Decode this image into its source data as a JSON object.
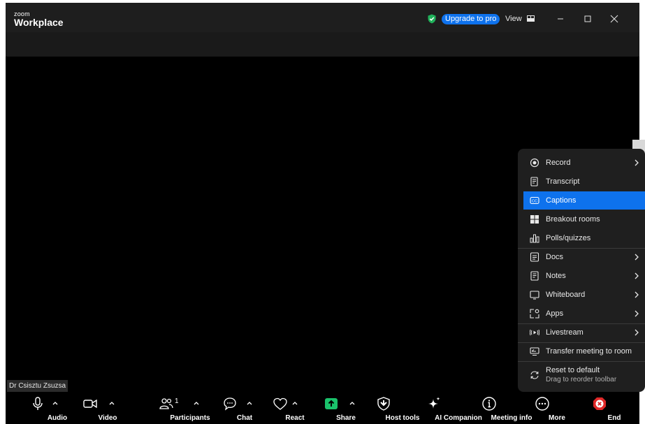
{
  "titlebar": {
    "logo_small": "zoom",
    "logo_big": "Workplace",
    "upgrade_label": "Upgrade to pro",
    "view_label": "View"
  },
  "participant_name": "Dr Csisztu Zsuzsa",
  "toolbar": {
    "audio": "Audio",
    "video": "Video",
    "participants": "Participants",
    "participants_count": "1",
    "chat": "Chat",
    "react": "React",
    "share": "Share",
    "host_tools": "Host tools",
    "ai_companion": "AI Companion",
    "meeting_info": "Meeting info",
    "more": "More",
    "end": "End"
  },
  "more_menu": {
    "items": [
      {
        "label": "Record",
        "icon": "record-icon",
        "submenu": true
      },
      {
        "label": "Transcript",
        "icon": "transcript-icon",
        "submenu": false
      },
      {
        "label": "Captions",
        "icon": "captions-icon",
        "submenu": false,
        "active": true
      },
      {
        "label": "Breakout rooms",
        "icon": "breakout-rooms-icon",
        "submenu": false
      },
      {
        "label": "Polls/quizzes",
        "icon": "polls-icon",
        "submenu": false
      },
      {
        "label": "Docs",
        "icon": "docs-icon",
        "submenu": true
      },
      {
        "label": "Notes",
        "icon": "notes-icon",
        "submenu": true
      },
      {
        "label": "Whiteboard",
        "icon": "whiteboard-icon",
        "submenu": true
      },
      {
        "label": "Apps",
        "icon": "apps-icon",
        "submenu": true
      },
      {
        "label": "Livestream",
        "icon": "livestream-icon",
        "submenu": true
      },
      {
        "label": "Transfer meeting to room",
        "icon": "transfer-icon",
        "submenu": false
      },
      {
        "label": "Reset to default",
        "sublabel": "Drag to reorder toolbar",
        "icon": "reset-icon",
        "submenu": false
      }
    ]
  },
  "colors": {
    "accent": "#0e72ed",
    "share_green": "#1ac26b",
    "end_red": "#e02828",
    "background": "#000000",
    "menu_bg": "#1f1f1f"
  }
}
